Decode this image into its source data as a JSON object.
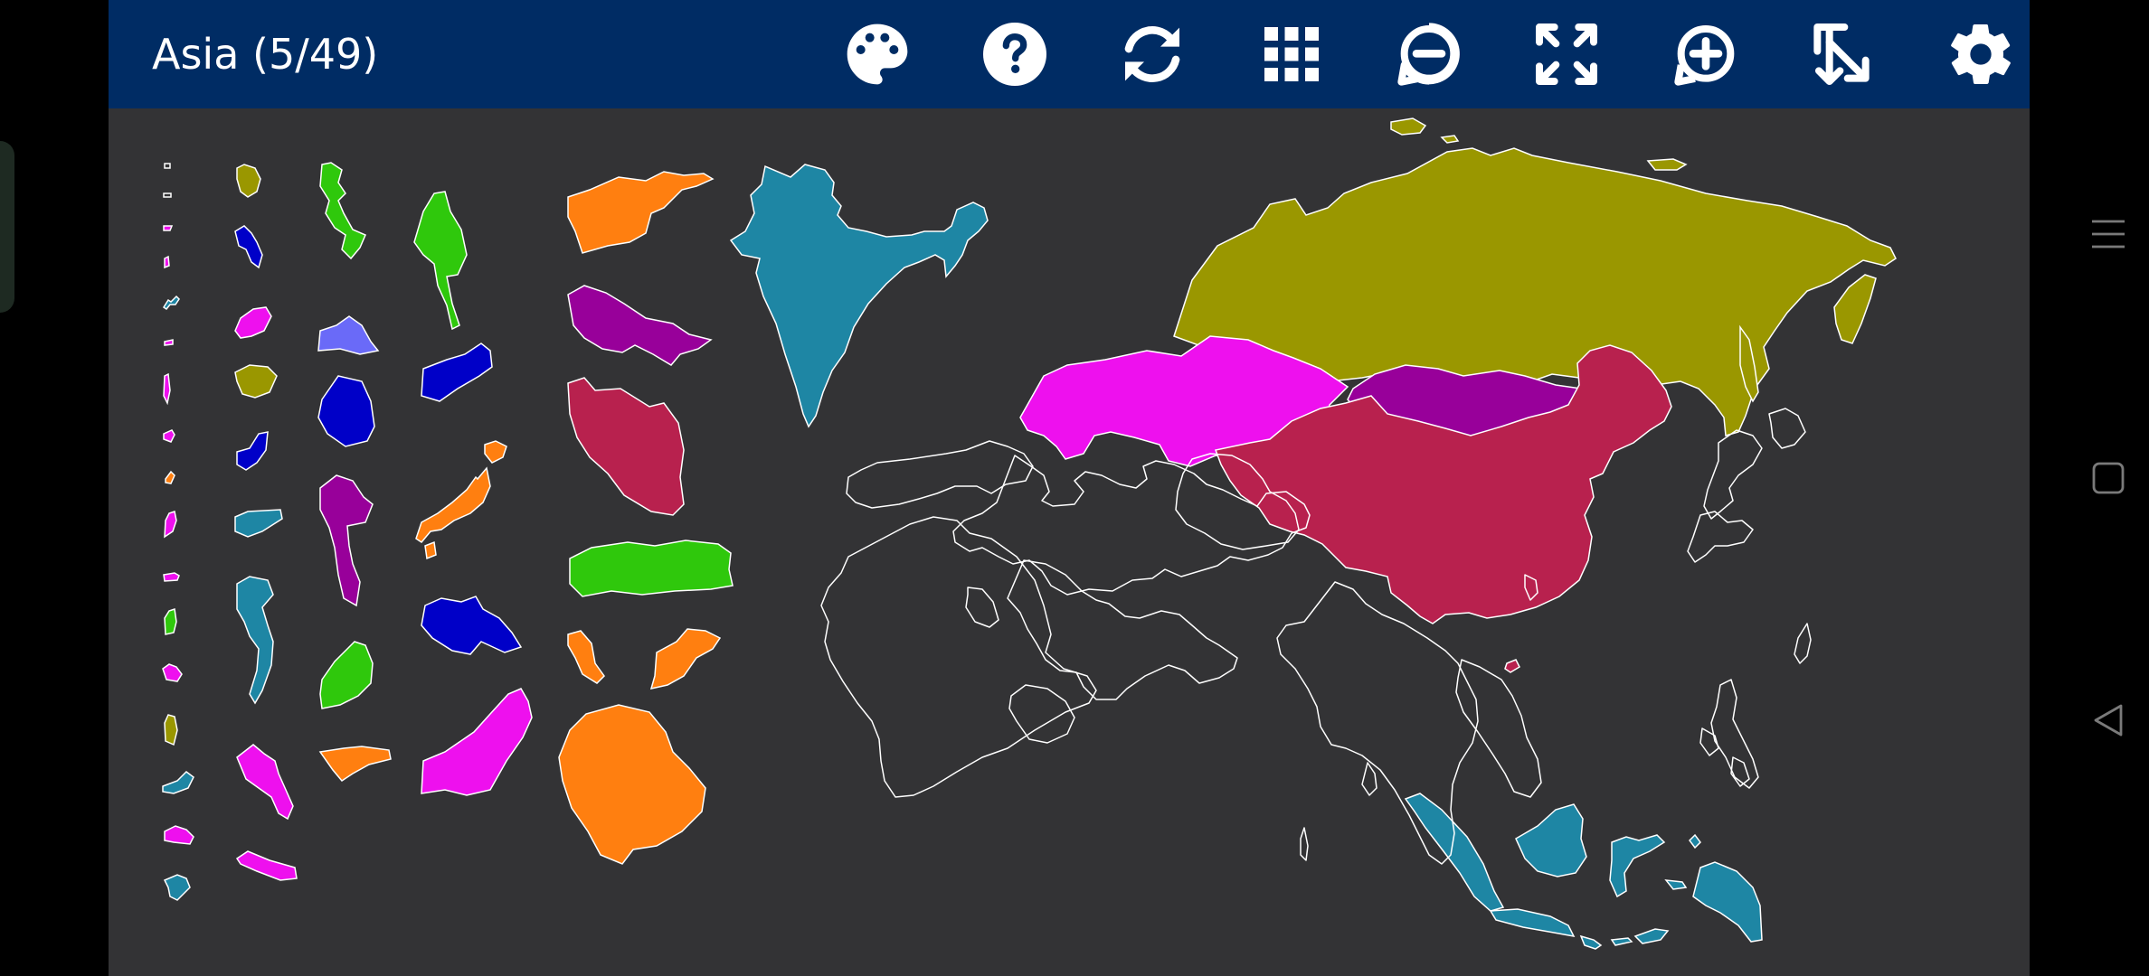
{
  "header": {
    "title": "Asia (5/49)"
  },
  "toolbar": [
    {
      "name": "palette-button",
      "icon": "palette-icon"
    },
    {
      "name": "help-button",
      "icon": "question-icon"
    },
    {
      "name": "restart-button",
      "icon": "refresh-icon"
    },
    {
      "name": "grid-button",
      "icon": "grid-icon"
    },
    {
      "name": "zoom-out-button",
      "icon": "zoom-out-icon"
    },
    {
      "name": "fit-screen-button",
      "icon": "fit-screen-icon"
    },
    {
      "name": "zoom-in-button",
      "icon": "zoom-in-icon"
    },
    {
      "name": "auto-place-button",
      "icon": "auto-place-icon"
    },
    {
      "name": "settings-button",
      "icon": "gear-icon"
    }
  ],
  "colors": {
    "header": "#002c64",
    "canvas": "#333335",
    "outline": "#ffffff",
    "olive": "#9a9700",
    "magenta": "#ee10ee",
    "purple": "#98009a",
    "crimson": "#b8214e",
    "teal": "#1e86a4",
    "orange": "#ff7f10",
    "green": "#2fc80c",
    "blue": "#0000c8",
    "periwinkle": "#6a6af8"
  },
  "system_nav": [
    "menu-icon",
    "home-icon",
    "back-icon"
  ]
}
